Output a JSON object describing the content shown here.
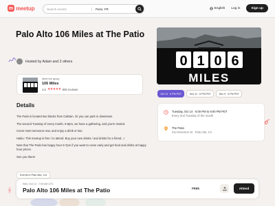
{
  "header": {
    "logo_text": "meetup",
    "search_placeholder": "Search events",
    "search_location": "Paris, FR",
    "language": "English",
    "login": "Log in",
    "signup": "Sign up"
  },
  "event": {
    "title": "Palo Alto 106 Miles at The Patio",
    "hosted_by": "Hosted by Adam and 2 others"
  },
  "group": {
    "meet_label": "Meet the group",
    "name": "106 Miles",
    "rating": "4.6",
    "reviews": "806 reviews",
    "thumb_digits": "0106",
    "thumb_word": "MILES"
  },
  "details": {
    "heading": "Details",
    "paragraphs": [
      "The Patio is located two blocks from Caltrain. Or you can park in downtown.",
      "The second Tuesday of every month, 6-9pm, we have a gathering, and you're invited.",
      "Come meet someone new, and enjoy a drink or two.",
      "Haiku: This meetup is free / to attend. Buy your own drinks / and drinks for a friend...!",
      "Note that The Patio has happy hour 5-7pm if you want to come early and get food and drinks at happy hour prices.",
      "See you there!"
    ],
    "tag": "Events in Palo Alto, CA"
  },
  "image": {
    "digits": [
      "0",
      "1",
      "0",
      "6"
    ],
    "word": "MILES"
  },
  "date_chips": [
    {
      "label": "Oct 14 · 6 PM PDT",
      "active": true
    },
    {
      "label": "Nov 11 · 6 PM PDT",
      "active": false
    },
    {
      "label": "Dec 9 · 6 PM PDT",
      "active": false
    }
  ],
  "info": {
    "datetime": "Tuesday, Oct 14 · 6:00 PM to 9:00 PM PDT",
    "recurrence": "Every 2nd Tuesday of the month",
    "venue": "The Patio",
    "address": "412 Emerson St · Palo Alto, CA"
  },
  "bottombar": {
    "date": "Wed, Oct 14 · 7:00 AM UTC",
    "title": "Palo Alto 106 Miles at The Patio",
    "price": "FREE",
    "attend": "Attend"
  },
  "colors": {
    "brand": "#f65858",
    "accent": "#6b59d3",
    "dark": "#1f1f1f"
  }
}
